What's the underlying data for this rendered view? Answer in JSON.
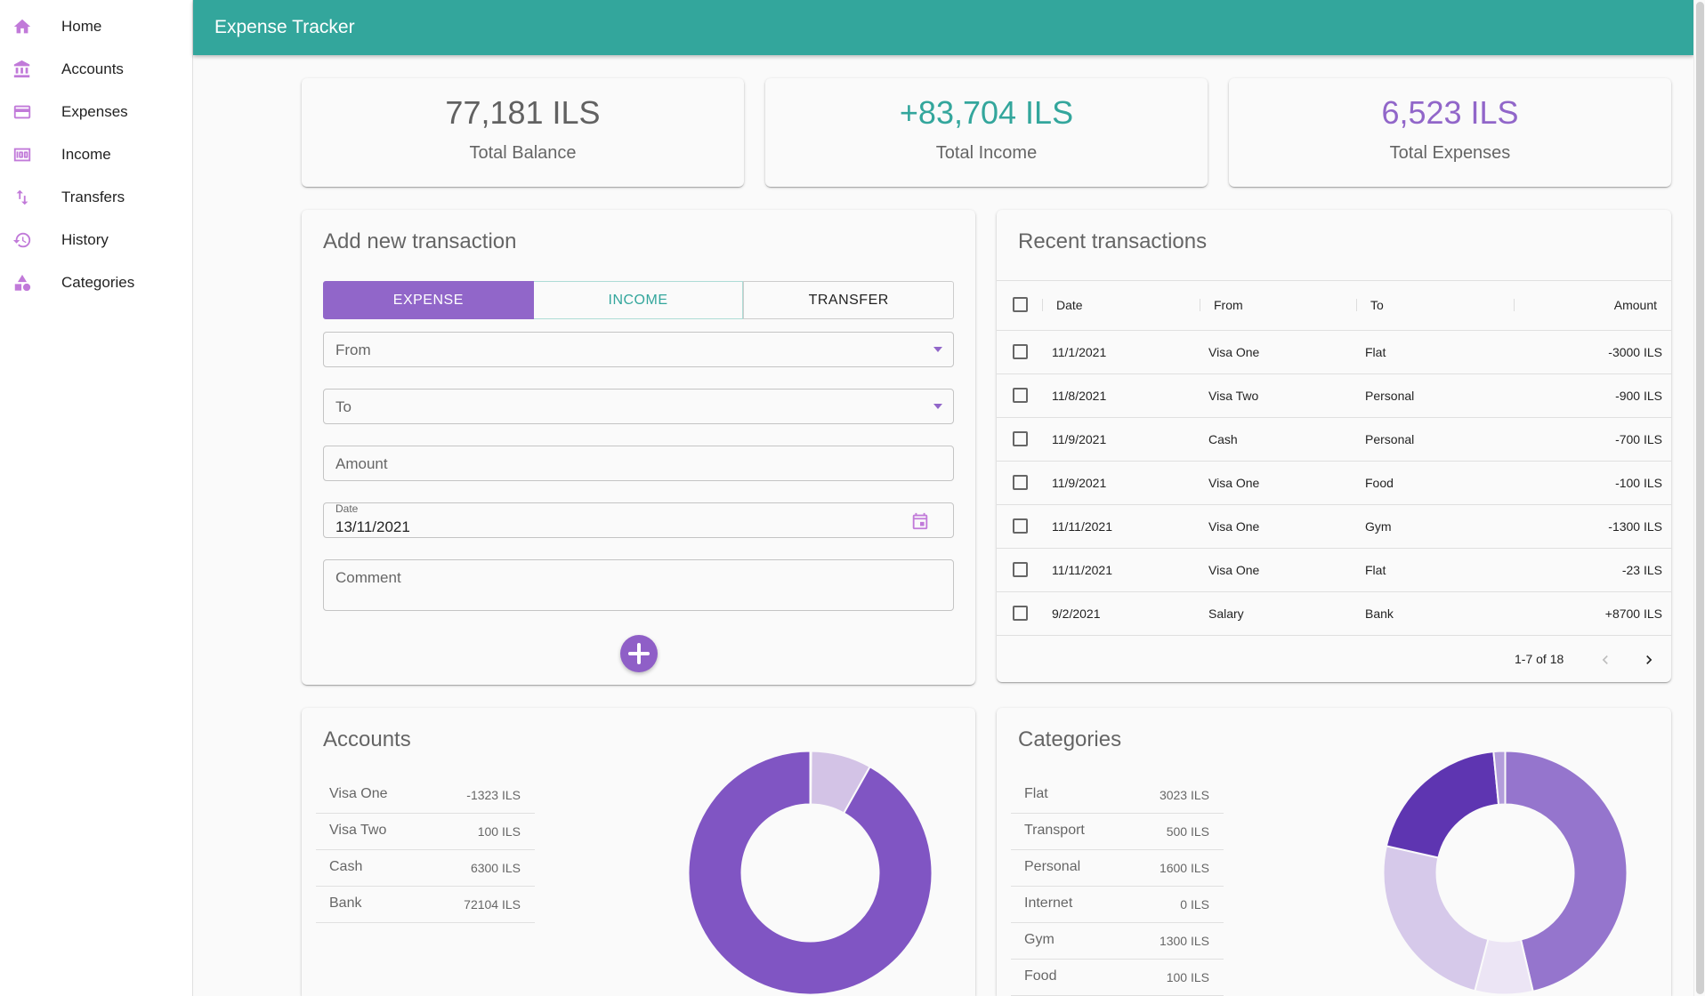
{
  "app": {
    "title": "Expense Tracker"
  },
  "sidebar": {
    "items": [
      {
        "label": "Home",
        "icon": "home-icon"
      },
      {
        "label": "Accounts",
        "icon": "bank-icon"
      },
      {
        "label": "Expenses",
        "icon": "credit-card-icon"
      },
      {
        "label": "Income",
        "icon": "money-icon"
      },
      {
        "label": "Transfers",
        "icon": "swap-vert-icon"
      },
      {
        "label": "History",
        "icon": "history-icon"
      },
      {
        "label": "Categories",
        "icon": "category-icon"
      }
    ]
  },
  "stats": {
    "balance": {
      "value": "77,181 ILS",
      "label": "Total Balance"
    },
    "income": {
      "value": "+83,704 ILS",
      "label": "Total Income"
    },
    "expenses": {
      "value": "6,523 ILS",
      "label": "Total Expenses"
    }
  },
  "add_transaction": {
    "title": "Add new transaction",
    "tabs": [
      "EXPENSE",
      "INCOME",
      "TRANSFER"
    ],
    "selected_tab": "EXPENSE",
    "from_placeholder": "From",
    "to_placeholder": "To",
    "amount_placeholder": "Amount",
    "date_label": "Date",
    "date_value": "13/11/2021",
    "comment_placeholder": "Comment"
  },
  "recent": {
    "title": "Recent transactions",
    "columns": [
      "Date",
      "From",
      "To",
      "Amount"
    ],
    "rows": [
      {
        "date": "11/1/2021",
        "from": "Visa One",
        "to": "Flat",
        "amount": "-3000 ILS"
      },
      {
        "date": "11/8/2021",
        "from": "Visa Two",
        "to": "Personal",
        "amount": "-900 ILS"
      },
      {
        "date": "11/9/2021",
        "from": "Cash",
        "to": "Personal",
        "amount": "-700 ILS"
      },
      {
        "date": "11/9/2021",
        "from": "Visa One",
        "to": "Food",
        "amount": "-100 ILS"
      },
      {
        "date": "11/11/2021",
        "from": "Visa One",
        "to": "Gym",
        "amount": "-1300 ILS"
      },
      {
        "date": "11/11/2021",
        "from": "Visa One",
        "to": "Flat",
        "amount": "-23 ILS"
      },
      {
        "date": "9/2/2021",
        "from": "Salary",
        "to": "Bank",
        "amount": "+8700 ILS"
      }
    ],
    "pagination": "1-7 of 18"
  },
  "accounts": {
    "title": "Accounts",
    "items": [
      {
        "name": "Visa One",
        "value": "-1323 ILS"
      },
      {
        "name": "Visa Two",
        "value": "100 ILS"
      },
      {
        "name": "Cash",
        "value": "6300 ILS"
      },
      {
        "name": "Bank",
        "value": "72104 ILS"
      }
    ]
  },
  "categories": {
    "title": "Categories",
    "items": [
      {
        "name": "Flat",
        "value": "3023 ILS"
      },
      {
        "name": "Transport",
        "value": "500 ILS"
      },
      {
        "name": "Personal",
        "value": "1600 ILS"
      },
      {
        "name": "Internet",
        "value": "0 ILS"
      },
      {
        "name": "Gym",
        "value": "1300 ILS"
      },
      {
        "name": "Food",
        "value": "100 ILS"
      }
    ]
  },
  "colors": {
    "teal": "#33a69c",
    "purple": "#9166c9",
    "balance_text": "#616161",
    "income_text": "#33a69c",
    "expense_text": "#9166c9"
  },
  "chart_data": [
    {
      "type": "pie",
      "variant": "donut",
      "categories": [
        "Visa One",
        "Visa Two",
        "Cash",
        "Bank"
      ],
      "values": [
        0,
        100,
        6300,
        72104
      ],
      "colors": [
        "#7b4fbf",
        "#d3c3e6",
        "#d3c3e6",
        "#8055c3"
      ]
    },
    {
      "type": "pie",
      "variant": "donut",
      "categories": [
        "Flat",
        "Transport",
        "Personal",
        "Internet",
        "Gym",
        "Food"
      ],
      "values": [
        3023,
        500,
        1600,
        0,
        1300,
        100
      ],
      "colors": [
        "#9575cd",
        "#ece5f5",
        "#d6c9ea",
        "#b39ddb",
        "#5e35b1",
        "#b39ddb"
      ]
    }
  ]
}
